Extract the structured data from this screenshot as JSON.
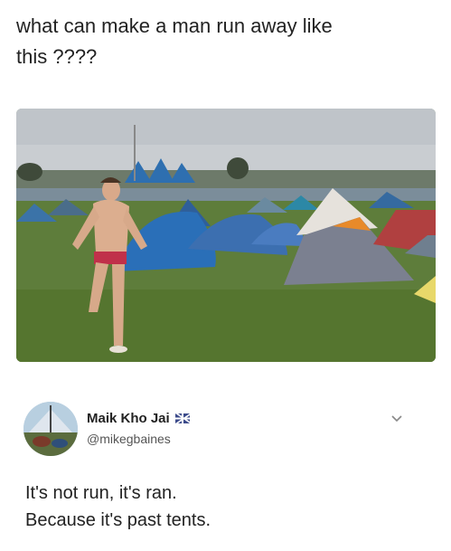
{
  "caption": {
    "line1": "what can make a man  run away like",
    "line2": "this ????"
  },
  "photo": {
    "description_icon": "festival-photo"
  },
  "tweet": {
    "display_name": "Maik Kho Jai",
    "handle": "@mikegbaines",
    "flag_icon": "flag-icon",
    "text_line1": "It's not run, it's ran.",
    "text_line2": "Because it's past tents."
  },
  "colors": {
    "text": "#222222",
    "handle": "#555555",
    "grass": "#5f7f3c",
    "sky": "#c8ccd0"
  }
}
